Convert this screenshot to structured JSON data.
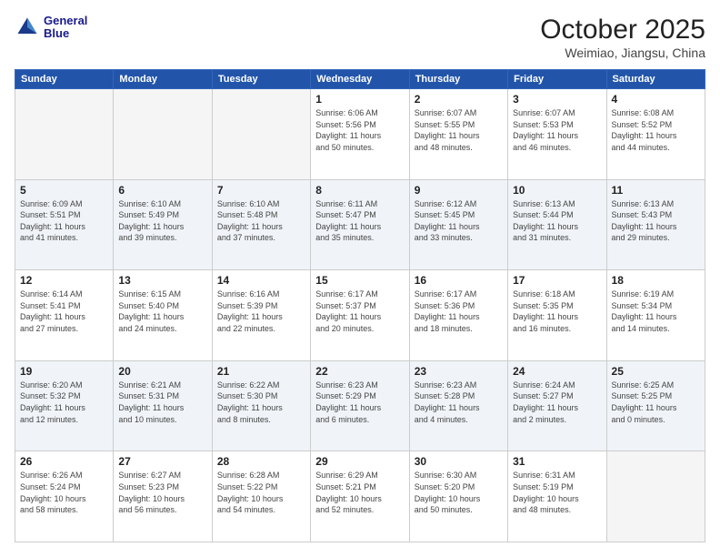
{
  "logo": {
    "line1": "General",
    "line2": "Blue"
  },
  "title": "October 2025",
  "subtitle": "Weimiao, Jiangsu, China",
  "headers": [
    "Sunday",
    "Monday",
    "Tuesday",
    "Wednesday",
    "Thursday",
    "Friday",
    "Saturday"
  ],
  "weeks": [
    [
      {
        "day": "",
        "info": ""
      },
      {
        "day": "",
        "info": ""
      },
      {
        "day": "",
        "info": ""
      },
      {
        "day": "1",
        "info": "Sunrise: 6:06 AM\nSunset: 5:56 PM\nDaylight: 11 hours\nand 50 minutes."
      },
      {
        "day": "2",
        "info": "Sunrise: 6:07 AM\nSunset: 5:55 PM\nDaylight: 11 hours\nand 48 minutes."
      },
      {
        "day": "3",
        "info": "Sunrise: 6:07 AM\nSunset: 5:53 PM\nDaylight: 11 hours\nand 46 minutes."
      },
      {
        "day": "4",
        "info": "Sunrise: 6:08 AM\nSunset: 5:52 PM\nDaylight: 11 hours\nand 44 minutes."
      }
    ],
    [
      {
        "day": "5",
        "info": "Sunrise: 6:09 AM\nSunset: 5:51 PM\nDaylight: 11 hours\nand 41 minutes."
      },
      {
        "day": "6",
        "info": "Sunrise: 6:10 AM\nSunset: 5:49 PM\nDaylight: 11 hours\nand 39 minutes."
      },
      {
        "day": "7",
        "info": "Sunrise: 6:10 AM\nSunset: 5:48 PM\nDaylight: 11 hours\nand 37 minutes."
      },
      {
        "day": "8",
        "info": "Sunrise: 6:11 AM\nSunset: 5:47 PM\nDaylight: 11 hours\nand 35 minutes."
      },
      {
        "day": "9",
        "info": "Sunrise: 6:12 AM\nSunset: 5:45 PM\nDaylight: 11 hours\nand 33 minutes."
      },
      {
        "day": "10",
        "info": "Sunrise: 6:13 AM\nSunset: 5:44 PM\nDaylight: 11 hours\nand 31 minutes."
      },
      {
        "day": "11",
        "info": "Sunrise: 6:13 AM\nSunset: 5:43 PM\nDaylight: 11 hours\nand 29 minutes."
      }
    ],
    [
      {
        "day": "12",
        "info": "Sunrise: 6:14 AM\nSunset: 5:41 PM\nDaylight: 11 hours\nand 27 minutes."
      },
      {
        "day": "13",
        "info": "Sunrise: 6:15 AM\nSunset: 5:40 PM\nDaylight: 11 hours\nand 24 minutes."
      },
      {
        "day": "14",
        "info": "Sunrise: 6:16 AM\nSunset: 5:39 PM\nDaylight: 11 hours\nand 22 minutes."
      },
      {
        "day": "15",
        "info": "Sunrise: 6:17 AM\nSunset: 5:37 PM\nDaylight: 11 hours\nand 20 minutes."
      },
      {
        "day": "16",
        "info": "Sunrise: 6:17 AM\nSunset: 5:36 PM\nDaylight: 11 hours\nand 18 minutes."
      },
      {
        "day": "17",
        "info": "Sunrise: 6:18 AM\nSunset: 5:35 PM\nDaylight: 11 hours\nand 16 minutes."
      },
      {
        "day": "18",
        "info": "Sunrise: 6:19 AM\nSunset: 5:34 PM\nDaylight: 11 hours\nand 14 minutes."
      }
    ],
    [
      {
        "day": "19",
        "info": "Sunrise: 6:20 AM\nSunset: 5:32 PM\nDaylight: 11 hours\nand 12 minutes."
      },
      {
        "day": "20",
        "info": "Sunrise: 6:21 AM\nSunset: 5:31 PM\nDaylight: 11 hours\nand 10 minutes."
      },
      {
        "day": "21",
        "info": "Sunrise: 6:22 AM\nSunset: 5:30 PM\nDaylight: 11 hours\nand 8 minutes."
      },
      {
        "day": "22",
        "info": "Sunrise: 6:23 AM\nSunset: 5:29 PM\nDaylight: 11 hours\nand 6 minutes."
      },
      {
        "day": "23",
        "info": "Sunrise: 6:23 AM\nSunset: 5:28 PM\nDaylight: 11 hours\nand 4 minutes."
      },
      {
        "day": "24",
        "info": "Sunrise: 6:24 AM\nSunset: 5:27 PM\nDaylight: 11 hours\nand 2 minutes."
      },
      {
        "day": "25",
        "info": "Sunrise: 6:25 AM\nSunset: 5:25 PM\nDaylight: 11 hours\nand 0 minutes."
      }
    ],
    [
      {
        "day": "26",
        "info": "Sunrise: 6:26 AM\nSunset: 5:24 PM\nDaylight: 10 hours\nand 58 minutes."
      },
      {
        "day": "27",
        "info": "Sunrise: 6:27 AM\nSunset: 5:23 PM\nDaylight: 10 hours\nand 56 minutes."
      },
      {
        "day": "28",
        "info": "Sunrise: 6:28 AM\nSunset: 5:22 PM\nDaylight: 10 hours\nand 54 minutes."
      },
      {
        "day": "29",
        "info": "Sunrise: 6:29 AM\nSunset: 5:21 PM\nDaylight: 10 hours\nand 52 minutes."
      },
      {
        "day": "30",
        "info": "Sunrise: 6:30 AM\nSunset: 5:20 PM\nDaylight: 10 hours\nand 50 minutes."
      },
      {
        "day": "31",
        "info": "Sunrise: 6:31 AM\nSunset: 5:19 PM\nDaylight: 10 hours\nand 48 minutes."
      },
      {
        "day": "",
        "info": ""
      }
    ]
  ]
}
